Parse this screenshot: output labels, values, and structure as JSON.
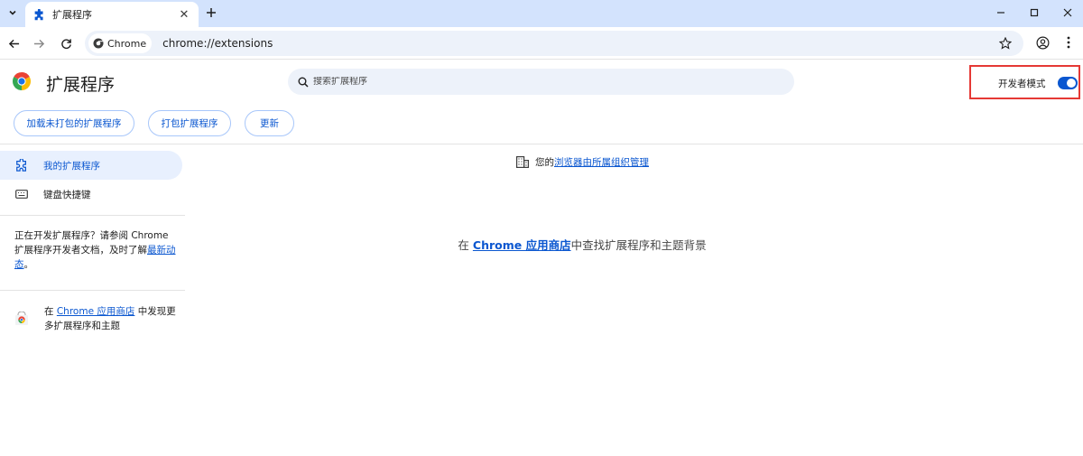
{
  "tab": {
    "title": "扩展程序"
  },
  "toolbar": {
    "chip_label": "Chrome",
    "url": "chrome://extensions"
  },
  "header": {
    "title": "扩展程序",
    "search_placeholder": "搜索扩展程序",
    "dev_mode_label": "开发者模式",
    "dev_mode_on": true
  },
  "actions": {
    "load_unpacked": "加载未打包的扩展程序",
    "pack": "打包扩展程序",
    "update": "更新"
  },
  "sidebar": {
    "items": [
      {
        "label": "我的扩展程序",
        "active": true
      },
      {
        "label": "键盘快捷键",
        "active": false
      }
    ],
    "dev_text_before": "正在开发扩展程序？请参阅 Chrome 扩展程序开发者文档，及时了解",
    "dev_link": "最新动态",
    "dev_text_after": "。",
    "store_prefix": "在 ",
    "store_link": "Chrome 应用商店",
    "store_suffix": " 中发现更多扩展程序和主题"
  },
  "main": {
    "managed_prefix": "您的",
    "managed_link": "浏览器由所属组织管理",
    "find_prefix": "在 ",
    "find_link": "Chrome 应用商店",
    "find_suffix": "中查找扩展程序和主题背景"
  },
  "colors": {
    "accent": "#0b57d0",
    "tabstrip": "#d3e3fd",
    "highlight_border": "#e53935"
  }
}
